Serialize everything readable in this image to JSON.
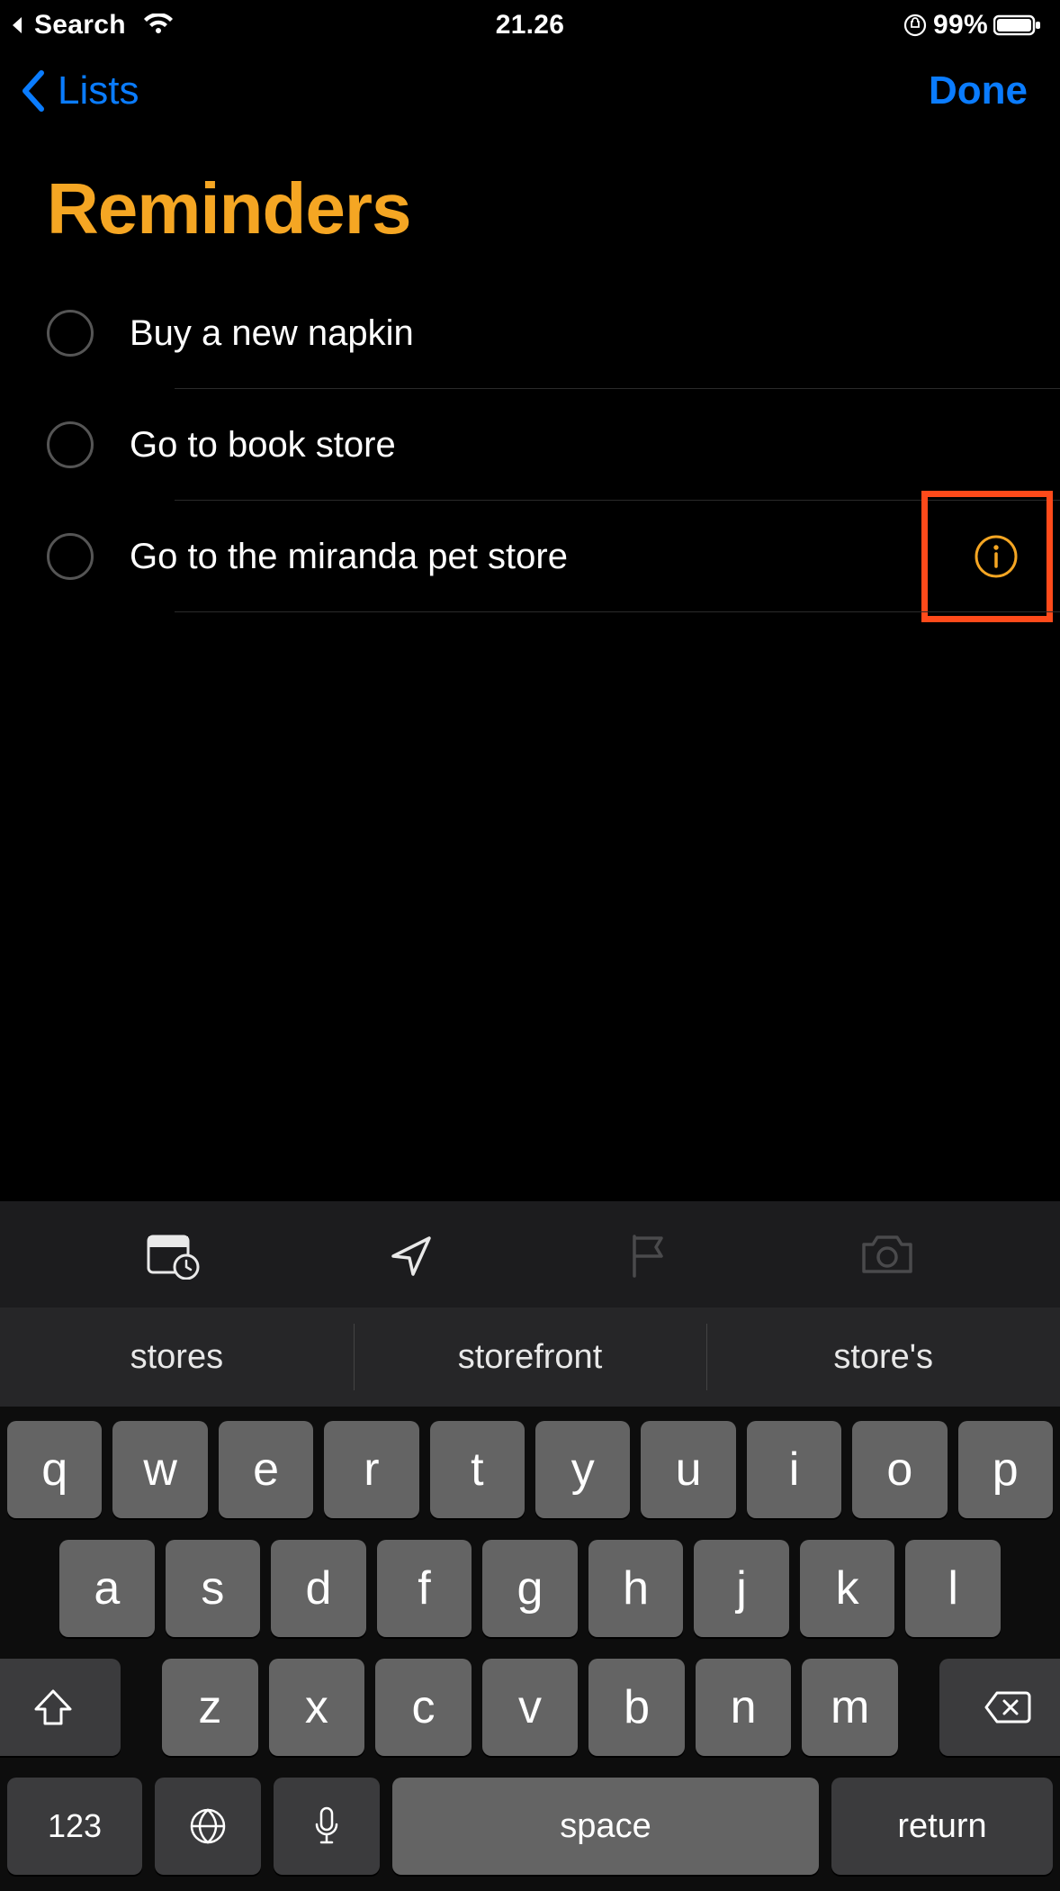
{
  "status": {
    "back_app": "Search",
    "time": "21.26",
    "battery_pct": "99%"
  },
  "nav": {
    "back_label": "Lists",
    "done_label": "Done"
  },
  "title": "Reminders",
  "reminders": [
    {
      "text": "Buy a new napkin",
      "show_info": false,
      "highlighted": false
    },
    {
      "text": "Go to book store",
      "show_info": false,
      "highlighted": false
    },
    {
      "text": "Go to the miranda pet store",
      "show_info": true,
      "highlighted": true
    }
  ],
  "accent_color": "#f5a623",
  "link_color": "#0a7cff",
  "highlight_color": "#ff4a1a",
  "accessory_icons": [
    "calendar-clock-icon",
    "location-arrow-icon",
    "flag-icon",
    "camera-icon"
  ],
  "suggestions": [
    "stores",
    "storefront",
    "store's"
  ],
  "keyboard": {
    "row1": [
      "q",
      "w",
      "e",
      "r",
      "t",
      "y",
      "u",
      "i",
      "o",
      "p"
    ],
    "row2": [
      "a",
      "s",
      "d",
      "f",
      "g",
      "h",
      "j",
      "k",
      "l"
    ],
    "row3": [
      "z",
      "x",
      "c",
      "v",
      "b",
      "n",
      "m"
    ],
    "numbers_label": "123",
    "space_label": "space",
    "return_label": "return"
  }
}
